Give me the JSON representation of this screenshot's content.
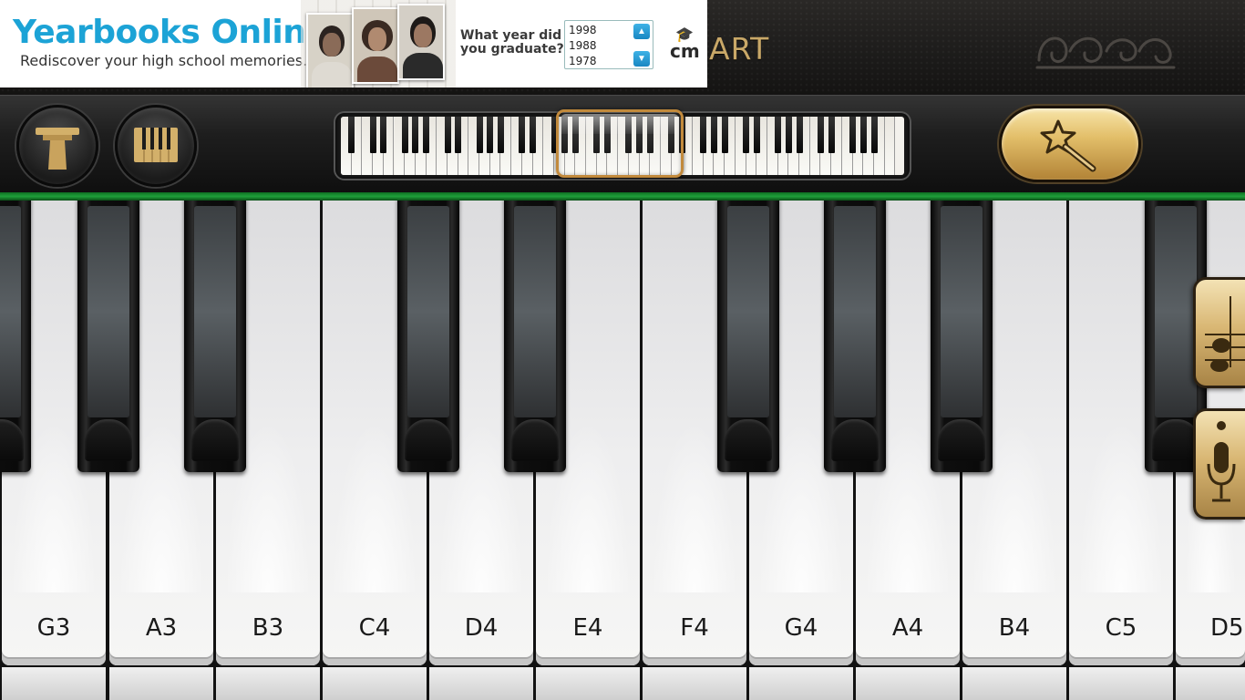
{
  "app": {
    "title": "ART"
  },
  "ad": {
    "title": "Yearbooks Online",
    "subtitle": "Rediscover your high school memories.",
    "question": "What year did you graduate?",
    "years": [
      "1998",
      "1988",
      "1978"
    ],
    "logo_text": "cm",
    "colors": {
      "brand": "#1ca3d6"
    }
  },
  "controls": {
    "left_buttons": [
      "pedal-icon",
      "keyboard-layout-icon"
    ],
    "magic_button_icon": "magic-wand-icon"
  },
  "keyboard": {
    "labels": [
      "G3",
      "A3",
      "B3",
      "C4",
      "D4",
      "E4",
      "F4",
      "G4",
      "A4",
      "B4",
      "C5",
      "D5"
    ]
  },
  "side_tabs": [
    "sheet-music-icon",
    "microphone-icon"
  ],
  "colors": {
    "accent_gold": "#d9b774",
    "divider_green": "#1fa03a"
  }
}
